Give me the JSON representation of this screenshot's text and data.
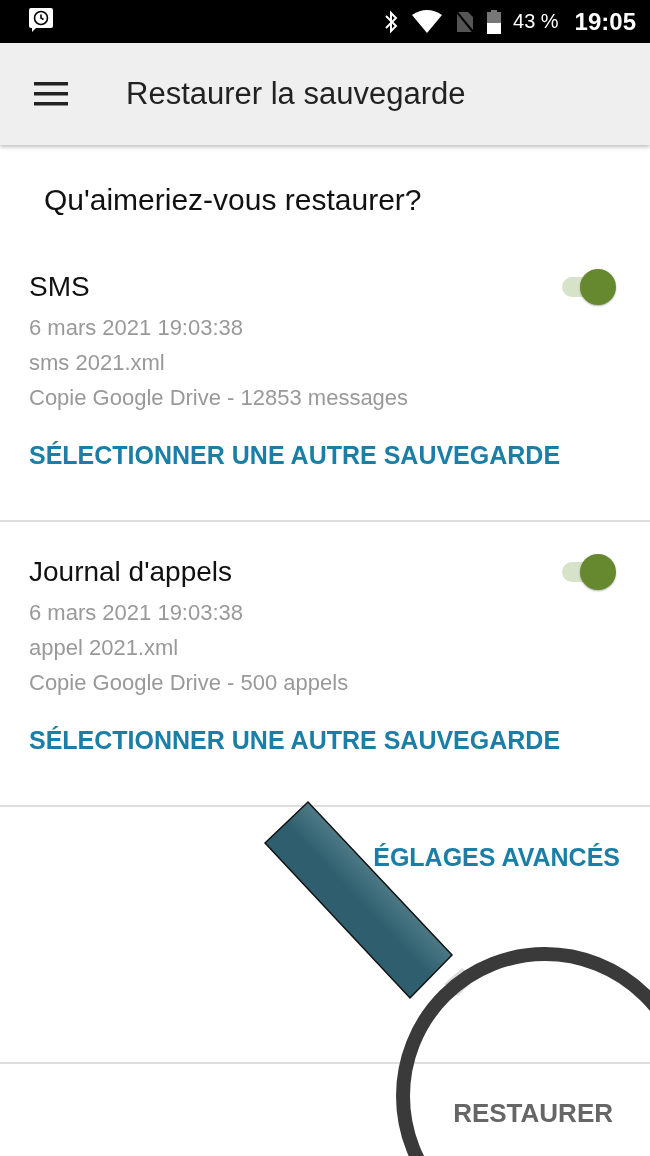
{
  "status_bar": {
    "battery": "43 %",
    "time": "19:05"
  },
  "app_bar": {
    "title": "Restaurer la sauvegarde"
  },
  "heading": "Qu'aimeriez-vous restaurer?",
  "sections": [
    {
      "title": "SMS",
      "on": true,
      "lines": [
        "6 mars 2021 19:03:38",
        "sms 2021.xml",
        "Copie Google Drive - 12853 messages"
      ],
      "link": "SÉLECTIONNER UNE AUTRE SAUVEGARDE"
    },
    {
      "title": "Journal d'appels",
      "on": true,
      "lines": [
        "6 mars 2021 19:03:38",
        "appel 2021.xml",
        "Copie Google Drive - 500 appels"
      ],
      "link": "SÉLECTIONNER UNE AUTRE SAUVEGARDE"
    }
  ],
  "advanced_link": "ÉGLAGES AVANCÉS",
  "restore_button": "RESTAURER"
}
